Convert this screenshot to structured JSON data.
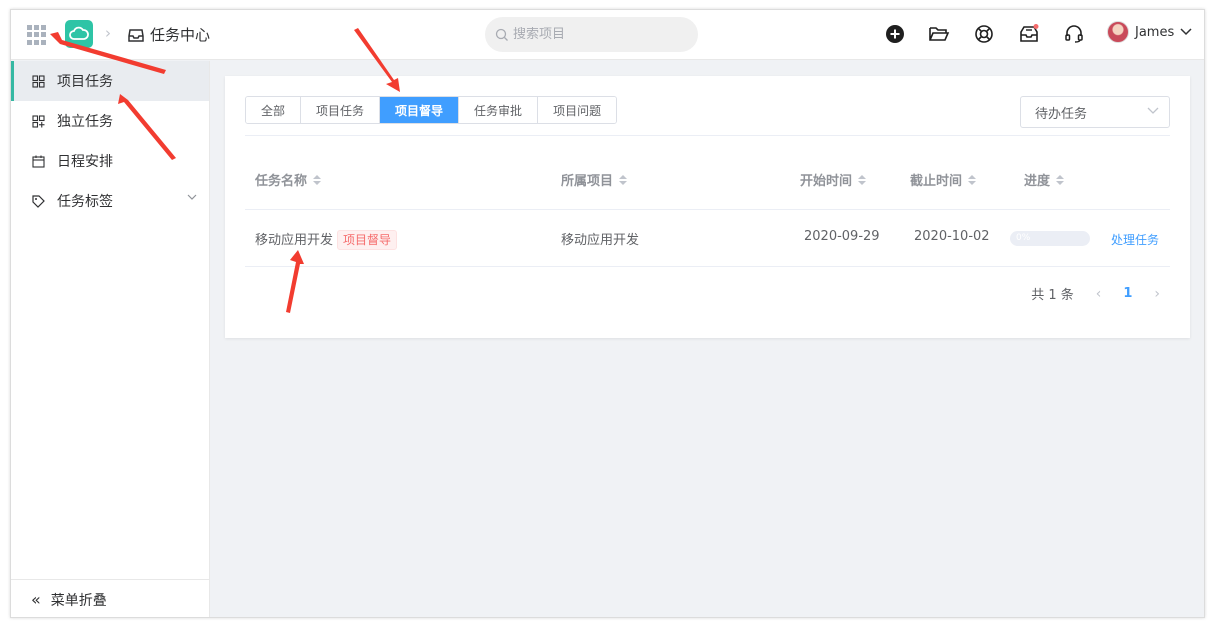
{
  "header": {
    "breadcrumb_title": "任务中心",
    "search_placeholder": "搜索项目",
    "user_name": "James",
    "notification_color": "#f56c6c"
  },
  "sidebar": {
    "items": [
      {
        "label": "项目任务",
        "icon": "grid-icon",
        "active": true
      },
      {
        "label": "独立任务",
        "icon": "apps-icon"
      },
      {
        "label": "日程安排",
        "icon": "calendar-icon"
      },
      {
        "label": "任务标签",
        "icon": "tag-icon"
      }
    ],
    "collapse_label": "菜单折叠"
  },
  "tabs": [
    "全部",
    "项目任务",
    "项目督导",
    "任务审批",
    "项目问题"
  ],
  "active_tab": "项目督导",
  "filter": {
    "selected": "待办任务"
  },
  "table": {
    "headers": [
      "任务名称",
      "所属项目",
      "开始时间",
      "截止时间",
      "进度"
    ],
    "rows": [
      {
        "name": "移动应用开发",
        "tag": "项目督导",
        "project": "移动应用开发",
        "start": "2020-09-29",
        "end": "2020-10-02",
        "progress": "0%",
        "action": "处理任务"
      }
    ]
  },
  "pagination": {
    "total": "共 1 条",
    "page": "1"
  },
  "colors": {
    "accent": "#409eff",
    "brand": "#2ec4a6",
    "annotation": "#f23c30"
  }
}
